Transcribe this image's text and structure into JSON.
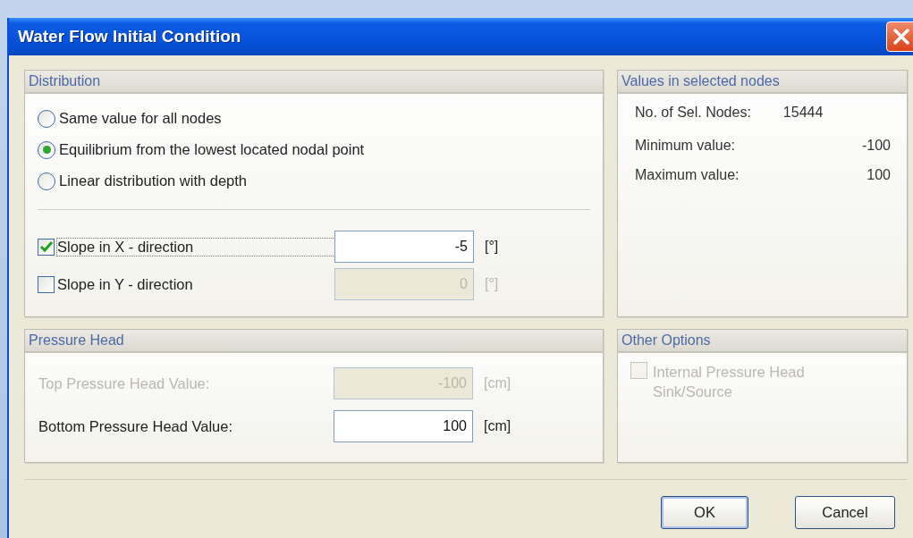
{
  "window": {
    "title": "Water Flow Initial Condition"
  },
  "distribution": {
    "title": "Distribution",
    "options": [
      {
        "label": "Same value for all nodes",
        "selected": false
      },
      {
        "label": "Equilibrium from the lowest located nodal point",
        "selected": true
      },
      {
        "label": "Linear distribution with depth",
        "selected": false
      }
    ],
    "slopes": [
      {
        "label": "Slope in X - direction",
        "checked": true,
        "value": "-5",
        "unit": "[°]",
        "disabled": false
      },
      {
        "label": "Slope in Y - direction",
        "checked": false,
        "value": "0",
        "unit": "[°]",
        "disabled": true
      }
    ]
  },
  "values_panel": {
    "title": "Values in selected nodes",
    "rows": [
      {
        "kind": "count",
        "label": "No. of Sel. Nodes:",
        "value": "15444"
      },
      {
        "kind": "value",
        "label": "Minimum value:",
        "value": "-100"
      },
      {
        "kind": "value",
        "label": "Maximum value:",
        "value": "100"
      }
    ]
  },
  "pressure_head": {
    "title": "Pressure Head",
    "fields": [
      {
        "label": "Top Pressure Head Value:",
        "value": "-100",
        "unit": "[cm]",
        "disabled": true
      },
      {
        "label": "Bottom Pressure Head Value:",
        "value": "100",
        "unit": "[cm]",
        "disabled": false
      }
    ]
  },
  "other_options": {
    "title": "Other Options",
    "checkboxes": [
      {
        "label": "Internal Pressure Head Sink/Source",
        "checked": false,
        "disabled": true
      }
    ]
  },
  "buttons": [
    {
      "label": "OK",
      "default": true
    },
    {
      "label": "Cancel",
      "default": false
    }
  ]
}
